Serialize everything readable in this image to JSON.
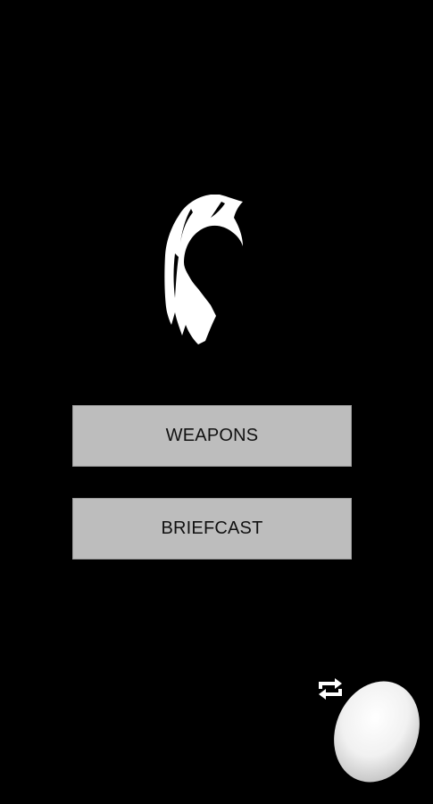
{
  "menu": {
    "weapons_label": "WEAPONS",
    "briefcase_label": "BRIEFCAST"
  },
  "icons": {
    "logo": "hooded-figure-icon",
    "refresh": "refresh-icon",
    "egg": "egg-icon"
  },
  "colors": {
    "background": "#000000",
    "button_fill": "#bdbdbd",
    "button_text": "#111111",
    "logo": "#ffffff"
  }
}
